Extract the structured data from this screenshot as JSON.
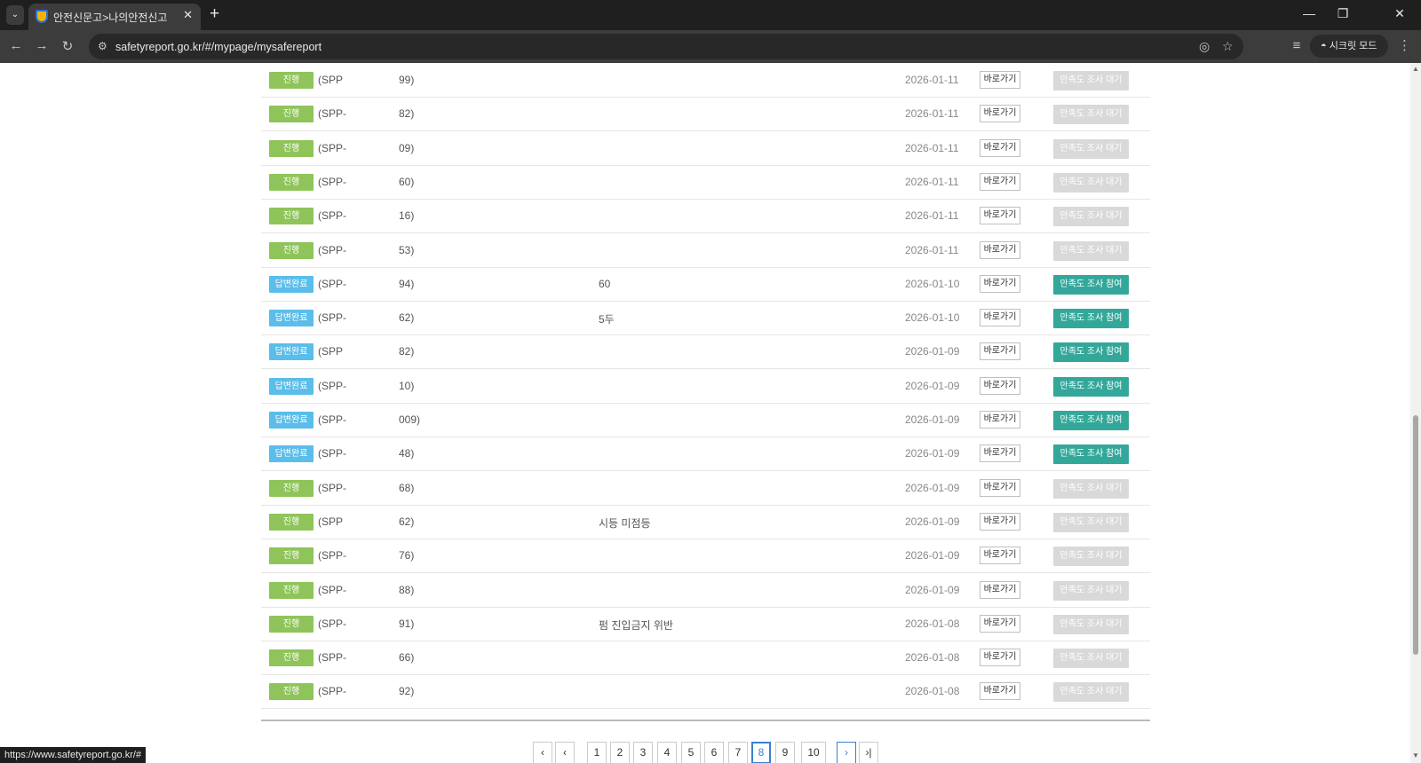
{
  "browser": {
    "tab_title": "안전신문고>나의안전신고",
    "url": "safetyreport.go.kr/#/mypage/mysafereport",
    "incognito_label": "시크릿 모드",
    "status_url": "https://www.safetyreport.go.kr/#"
  },
  "labels": {
    "go_button": "바로가기"
  },
  "colors": {
    "badge_progress": "#8fc45a",
    "badge_answered": "#5bbde9",
    "survey_wait": "#d9d9d9",
    "survey_join": "#33a89a",
    "pager_active": "#3a7fd0"
  },
  "rows": [
    {
      "status": "진행",
      "type": "progress",
      "id": "(SPP",
      "id2": "99)",
      "title": "",
      "date": "2026-01-11",
      "survey": "만족도 조사 대기",
      "survey_type": "wait"
    },
    {
      "status": "진행",
      "type": "progress",
      "id": "(SPP-",
      "id2": "82)",
      "title": "",
      "date": "2026-01-11",
      "survey": "만족도 조사 대기",
      "survey_type": "wait"
    },
    {
      "status": "진행",
      "type": "progress",
      "id": "(SPP-",
      "id2": "09)",
      "title": "",
      "date": "2026-01-11",
      "survey": "만족도 조사 대기",
      "survey_type": "wait"
    },
    {
      "status": "진행",
      "type": "progress",
      "id": "(SPP-",
      "id2": "60)",
      "title": "",
      "date": "2026-01-11",
      "survey": "만족도 조사 대기",
      "survey_type": "wait"
    },
    {
      "status": "진행",
      "type": "progress",
      "id": "(SPP-",
      "id2": "16)",
      "title": "",
      "date": "2026-01-11",
      "survey": "만족도 조사 대기",
      "survey_type": "wait"
    },
    {
      "status": "진행",
      "type": "progress",
      "id": "(SPP-",
      "id2": "53)",
      "title": "",
      "date": "2026-01-11",
      "survey": "만족도 조사 대기",
      "survey_type": "wait"
    },
    {
      "status": "답변완료",
      "type": "answered",
      "id": "(SPP-",
      "id2": "94)",
      "title": "60",
      "date": "2026-01-10",
      "survey": "만족도 조사 참여",
      "survey_type": "join"
    },
    {
      "status": "답변완료",
      "type": "answered",
      "id": "(SPP-",
      "id2": "62)",
      "title": "5두",
      "date": "2026-01-10",
      "survey": "만족도 조사 참여",
      "survey_type": "join"
    },
    {
      "status": "답변완료",
      "type": "answered",
      "id": "(SPP",
      "id2": "82)",
      "title": "",
      "date": "2026-01-09",
      "survey": "만족도 조사 참여",
      "survey_type": "join"
    },
    {
      "status": "답변완료",
      "type": "answered",
      "id": "(SPP-",
      "id2": "10)",
      "title": "",
      "date": "2026-01-09",
      "survey": "만족도 조사 참여",
      "survey_type": "join"
    },
    {
      "status": "답변완료",
      "type": "answered",
      "id": "(SPP-",
      "id2": "009)",
      "title": "",
      "date": "2026-01-09",
      "survey": "만족도 조사 참여",
      "survey_type": "join"
    },
    {
      "status": "답변완료",
      "type": "answered",
      "id": "(SPP-",
      "id2": "48)",
      "title": "",
      "date": "2026-01-09",
      "survey": "만족도 조사 참여",
      "survey_type": "join"
    },
    {
      "status": "진행",
      "type": "progress",
      "id": "(SPP-",
      "id2": "68)",
      "title": "",
      "date": "2026-01-09",
      "survey": "만족도 조사 대기",
      "survey_type": "wait"
    },
    {
      "status": "진행",
      "type": "progress",
      "id": "(SPP",
      "id2": "62)",
      "title": "시등 미점등",
      "date": "2026-01-09",
      "survey": "만족도 조사 대기",
      "survey_type": "wait"
    },
    {
      "status": "진행",
      "type": "progress",
      "id": "(SPP-",
      "id2": "76)",
      "title": "",
      "date": "2026-01-09",
      "survey": "만족도 조사 대기",
      "survey_type": "wait"
    },
    {
      "status": "진행",
      "type": "progress",
      "id": "(SPP-",
      "id2": "88)",
      "title": "",
      "date": "2026-01-09",
      "survey": "만족도 조사 대기",
      "survey_type": "wait"
    },
    {
      "status": "진행",
      "type": "progress",
      "id": "(SPP-",
      "id2": "91)",
      "title": "펌 진입금지 위반",
      "date": "2026-01-08",
      "survey": "만족도 조사 대기",
      "survey_type": "wait"
    },
    {
      "status": "진행",
      "type": "progress",
      "id": "(SPP-",
      "id2": "66)",
      "title": "",
      "date": "2026-01-08",
      "survey": "만족도 조사 대기",
      "survey_type": "wait"
    },
    {
      "status": "진행",
      "type": "progress",
      "id": "(SPP-",
      "id2": "92)",
      "title": "",
      "date": "2026-01-08",
      "survey": "만족도 조사 대기",
      "survey_type": "wait"
    }
  ],
  "pagination": {
    "pages": [
      "1",
      "2",
      "3",
      "4",
      "5",
      "6",
      "7",
      "8",
      "9",
      "10"
    ],
    "current": "8"
  }
}
